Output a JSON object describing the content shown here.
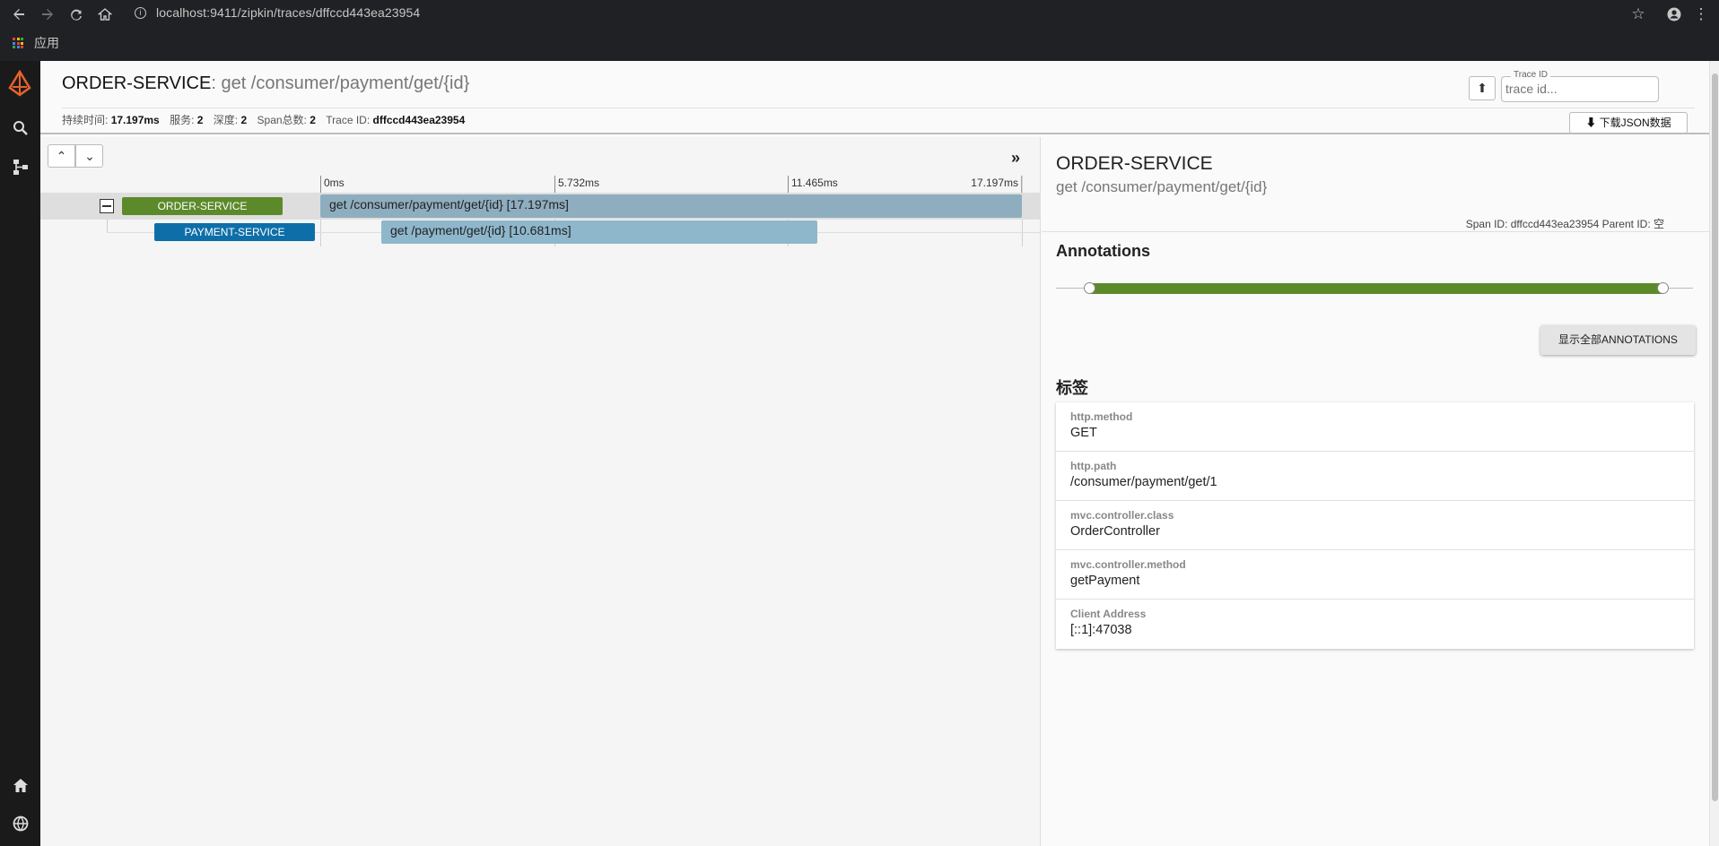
{
  "browser": {
    "url": "localhost:9411/zipkin/traces/dffccd443ea23954",
    "bookmark_apps": "应用"
  },
  "header": {
    "service": "ORDER-SERVICE",
    "operation": ": get /consumer/payment/get/{id}",
    "stats": {
      "duration_label": "持续时间:",
      "duration": "17.197ms",
      "services_label": "服务:",
      "services": "2",
      "depth_label": "深度:",
      "depth": "2",
      "spans_label": "Span总数:",
      "spans": "2",
      "traceid_label": "Trace ID:",
      "traceid": "dffccd443ea23954"
    },
    "trace_id_label": "Trace ID",
    "trace_id_placeholder": "trace id...",
    "download_label": "下载JSON数据"
  },
  "timeline": {
    "ticks": [
      "0ms",
      "5.732ms",
      "11.465ms",
      "17.197ms"
    ],
    "spans": [
      {
        "service": "ORDER-SERVICE",
        "label": "get /consumer/payment/get/{id} [17.197ms]",
        "service_color": "#5c8a2b",
        "bar_color": "#8eaebf"
      },
      {
        "service": "PAYMENT-SERVICE",
        "label": "get /payment/get/{id} [10.681ms]",
        "service_color": "#0e6fa8",
        "bar_color": "#8eb7cc"
      }
    ]
  },
  "detail": {
    "service": "ORDER-SERVICE",
    "operation": "get /consumer/payment/get/{id}",
    "ids": "Span ID: dffccd443ea23954   Parent ID: 空",
    "annotations_heading": "Annotations",
    "show_annotations_label": "显示全部ANNOTATIONS",
    "tags_heading": "标签",
    "tags": [
      {
        "key": "http.method",
        "value": "GET"
      },
      {
        "key": "http.path",
        "value": "/consumer/payment/get/1"
      },
      {
        "key": "mvc.controller.class",
        "value": "OrderController"
      },
      {
        "key": "mvc.controller.method",
        "value": "getPayment"
      },
      {
        "key": "Client Address",
        "value": "[::1]:47038"
      }
    ]
  }
}
